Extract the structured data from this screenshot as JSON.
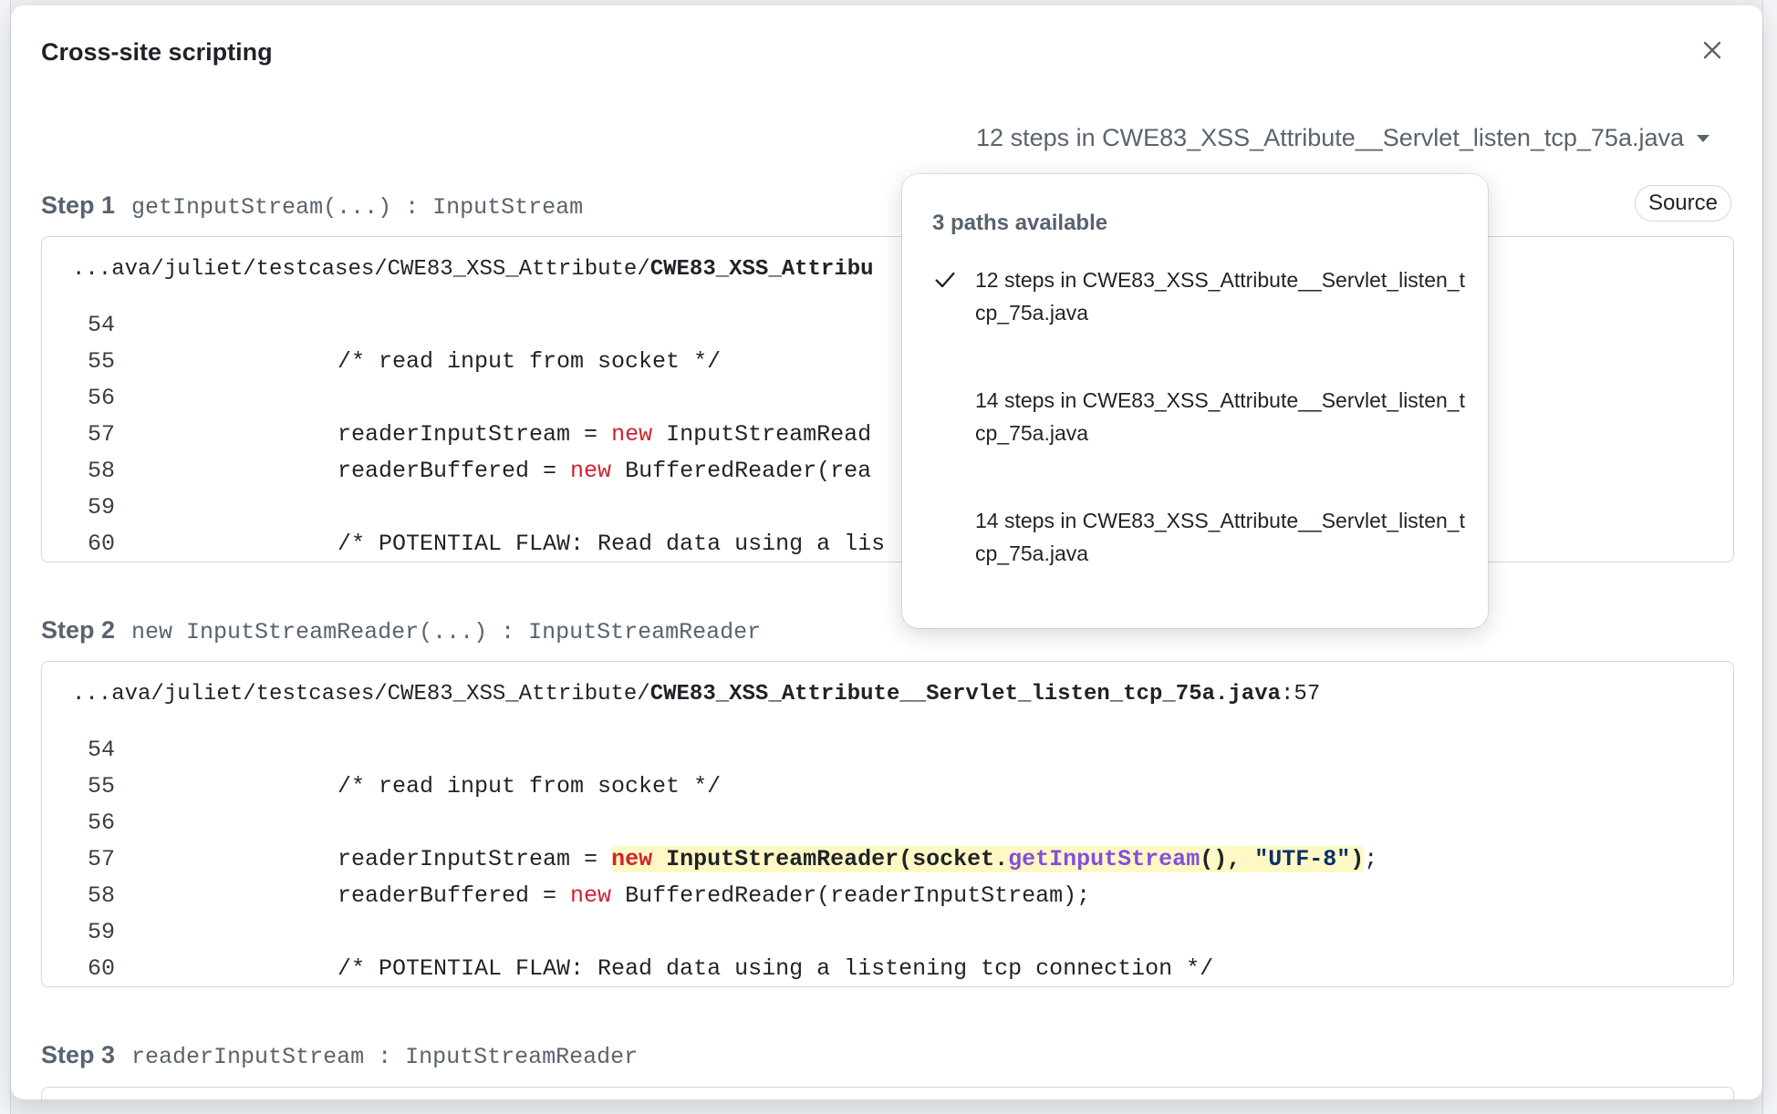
{
  "modal": {
    "title": "Cross-site scripting",
    "path_selector": "12 steps in CWE83_XSS_Attribute__Servlet_listen_tcp_75a.java",
    "source_button": "Source"
  },
  "dropdown": {
    "title": "3 paths available",
    "options": [
      {
        "label": "12 steps in CWE83_XSS_Attribute__Servlet_listen_tcp_75a.java",
        "selected": true
      },
      {
        "label": "14 steps in CWE83_XSS_Attribute__Servlet_listen_tcp_75a.java",
        "selected": false
      },
      {
        "label": "14 steps in CWE83_XSS_Attribute__Servlet_listen_tcp_75a.java",
        "selected": false
      }
    ]
  },
  "steps": [
    {
      "label": "Step 1",
      "signature": "getInputStream(...) : InputStream",
      "path_prefix": "...ava/juliet/testcases/CWE83_XSS_Attribute/",
      "file_name": "CWE83_XSS_Attribu",
      "line_suffix": "",
      "lines": [
        {
          "num": "54",
          "code": ""
        },
        {
          "num": "55",
          "code": "/* read input from socket */"
        },
        {
          "num": "56",
          "code": ""
        },
        {
          "num": "57",
          "pre": "readerInputStream = ",
          "kw": "new",
          "post": " InputStreamRead"
        },
        {
          "num": "58",
          "pre": "readerBuffered = ",
          "kw": "new",
          "post": " BufferedReader(rea"
        },
        {
          "num": "59",
          "code": ""
        },
        {
          "num": "60",
          "code": "/* POTENTIAL FLAW: Read data using a lis"
        }
      ]
    },
    {
      "label": "Step 2",
      "signature": "new InputStreamReader(...) : InputStreamReader",
      "path_prefix": "...ava/juliet/testcases/CWE83_XSS_Attribute/",
      "file_name": "CWE83_XSS_Attribute__Servlet_listen_tcp_75a.java",
      "line_suffix": ":57",
      "lines": [
        {
          "num": "54",
          "code": ""
        },
        {
          "num": "55",
          "code": "/* read input from socket */"
        },
        {
          "num": "56",
          "code": ""
        },
        {
          "num": "57",
          "pre": "readerInputStream = ",
          "hl_kw": "new",
          "hl_a": " InputStreamReader(socket.",
          "hl_fn": "getInputStream",
          "hl_b": "(), ",
          "hl_str": "\"UTF-8\"",
          "hl_c": ")",
          "post": ";"
        },
        {
          "num": "58",
          "pre": "readerBuffered = ",
          "kw": "new",
          "post": " BufferedReader(readerInputStream);"
        },
        {
          "num": "59",
          "code": ""
        },
        {
          "num": "60",
          "code": "/* POTENTIAL FLAW: Read data using a listening tcp connection */"
        }
      ]
    },
    {
      "label": "Step 3",
      "signature": "readerInputStream : InputStreamReader"
    }
  ]
}
